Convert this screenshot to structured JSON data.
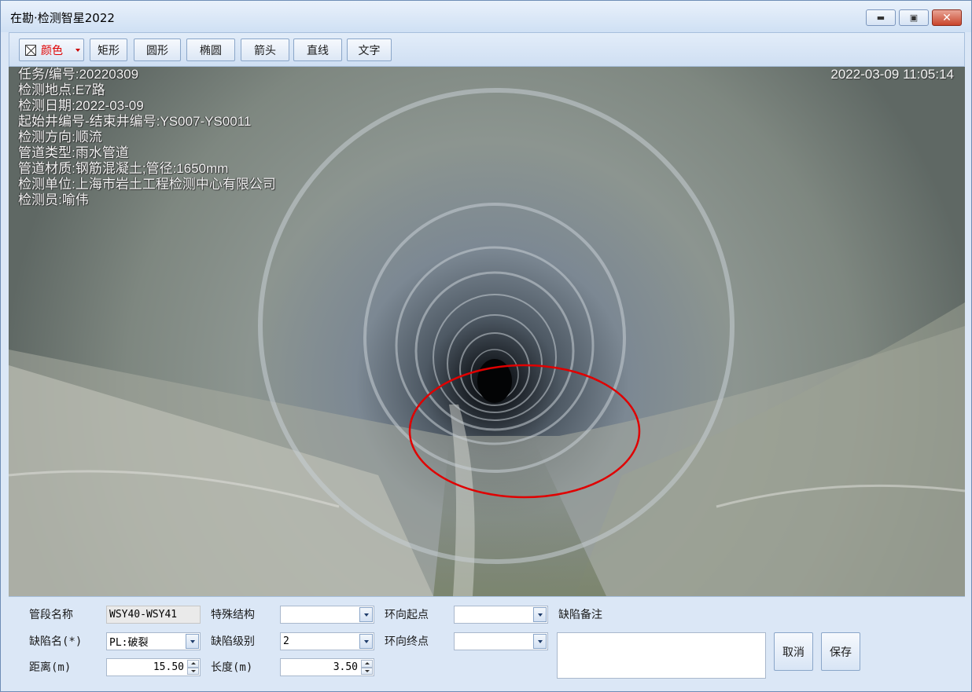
{
  "window": {
    "title": "在勘·检测智星2022",
    "minimize_symbol": "▬",
    "restore_symbol": "▣",
    "close_symbol": "✕"
  },
  "toolbar": {
    "color_label": "颜色",
    "rect_label": "矩形",
    "circle_label": "圆形",
    "ellipse_label": "椭圆",
    "arrow_label": "箭头",
    "line_label": "直线",
    "text_label": "文字"
  },
  "video": {
    "timestamp": "2022-03-09 11:05:14",
    "overlay_lines": [
      "任务/编号:20220309",
      "检测地点:E7路",
      "检测日期:2022-03-09",
      "起始井编号-结束井编号:YS007-YS0011",
      "检测方向:顺流",
      "管道类型:雨水管道",
      "管道材质:钢筋混凝土;管径:1650mm",
      "检测单位:上海市岩土工程检测中心有限公司",
      "检测员:喻伟"
    ],
    "annotation_color": "#e00000"
  },
  "form": {
    "segment_label": "管段名称",
    "segment_value": "WSY40-WSY41",
    "defect_name_label": "缺陷名(*)",
    "defect_name_value": "PL:破裂",
    "distance_label": "距离(m)",
    "distance_value": "15.50",
    "special_struct_label": "特殊结构",
    "special_struct_value": "",
    "defect_level_label": "缺陷级别",
    "defect_level_value": "2",
    "length_label": "长度(m)",
    "length_value": "3.50",
    "ring_start_label": "环向起点",
    "ring_start_value": "",
    "ring_end_label": "环向终点",
    "ring_end_value": "",
    "remark_label": "缺陷备注",
    "remark_value": "",
    "cancel_label": "取消",
    "save_label": "保存"
  }
}
